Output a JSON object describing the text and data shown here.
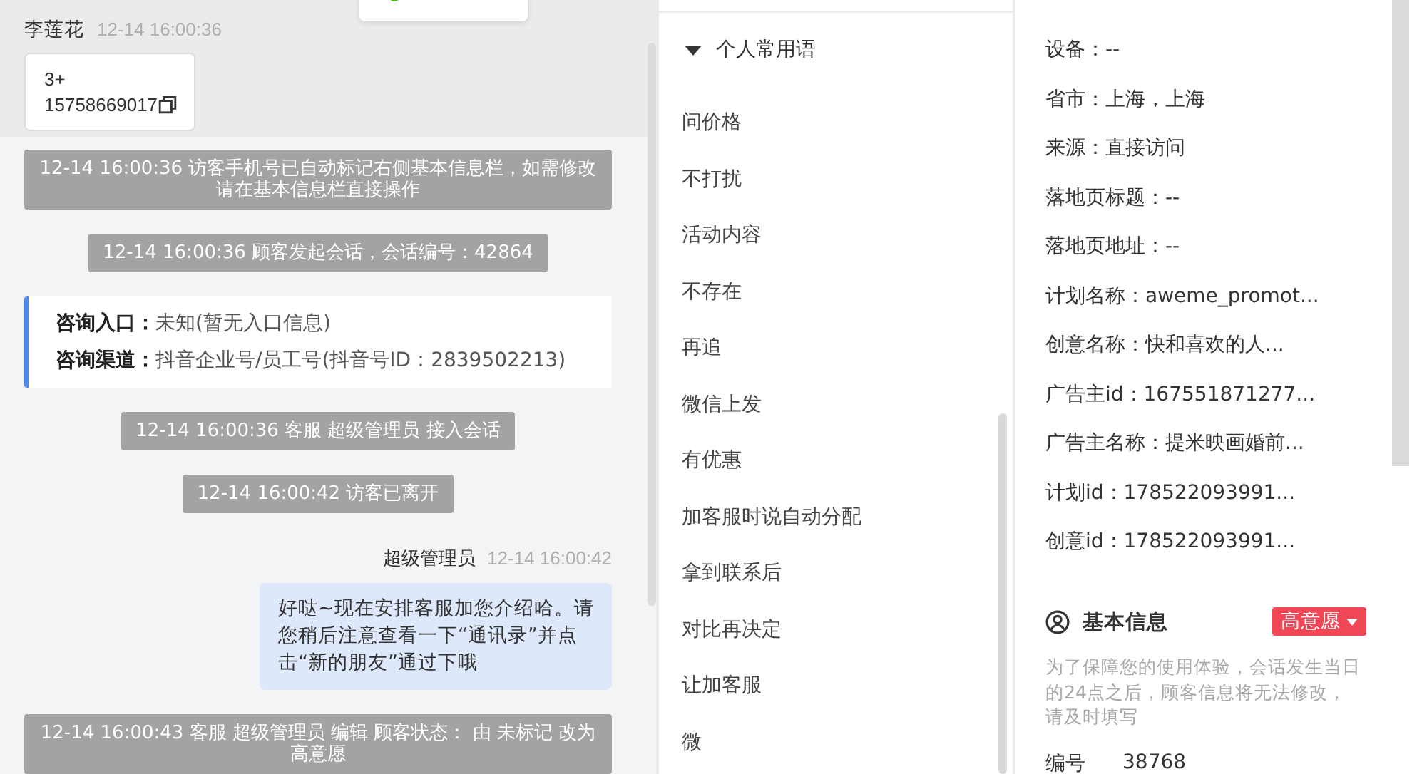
{
  "chat": {
    "visitor": {
      "name": "李莲花",
      "time": "12-14 16:00:36",
      "phone": "3+\n15758669017"
    },
    "messages": [
      {
        "kind": "system",
        "text": "12-14 16:00:36 访客手机号已自动标记右侧基本信息栏，如需修改请在基本信息栏直接操作"
      },
      {
        "kind": "system",
        "text": "12-14 16:00:36 顾客发起会话，会话编号：42864"
      },
      {
        "kind": "info",
        "rows": [
          {
            "label": "咨询入口：",
            "value": "未知(暂无入口信息)"
          },
          {
            "label": "咨询渠道：",
            "value": "抖音企业号/员工号(抖音号ID：2839502213)"
          }
        ]
      },
      {
        "kind": "system",
        "text": "12-14 16:00:36 客服 超级管理员 接入会话"
      },
      {
        "kind": "system",
        "text": "12-14 16:00:42 访客已离开"
      },
      {
        "kind": "agent",
        "sender": "超级管理员",
        "time": "12-14 16:00:42",
        "text": "好哒~现在安排客服加您介绍哈。请您稍后注意查看一下“通讯录”并点击“新的朋友”通过下哦"
      },
      {
        "kind": "system",
        "text": "12-14 16:00:43 客服 超级管理员 编辑 顾客状态： 由 未标记 改为高意愿"
      }
    ]
  },
  "quick_replies": {
    "group": "个人常用语",
    "expanded": true,
    "items": [
      "问价格",
      "不打扰",
      "活动内容",
      "不存在",
      "再追",
      "微信上发",
      "有优惠",
      "加客服时说自动分配",
      "拿到联系后",
      "对比再决定",
      "让加客服",
      "微"
    ]
  },
  "source_info": {
    "rows": [
      "设备：--",
      "省市：上海，上海",
      "来源：直接访问",
      "落地页标题：--",
      "落地页地址：--",
      "计划名称：aweme_promot...",
      "创意名称：快和喜欢的人...",
      "广告主id：167551871277...",
      "广告主名称：提米映画婚前...",
      "计划id：178522093991...",
      "创意id：178522093991..."
    ]
  },
  "basic_info": {
    "title": "基本信息",
    "intent_tag": "高意愿",
    "notice": "为了保障您的使用体验，会话发生当日的24点之后，顾客信息将无法修改，请及时填写",
    "fields": [
      {
        "label": "编号",
        "value": "38768"
      }
    ]
  }
}
